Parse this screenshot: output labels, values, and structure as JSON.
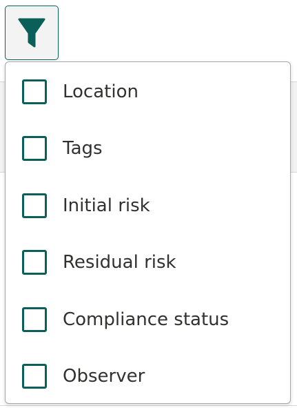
{
  "toolbar": {
    "filter_icon": "filter-icon",
    "accent_color": "#0b5f59"
  },
  "filter_menu": {
    "options": [
      {
        "label": "Location",
        "checked": false
      },
      {
        "label": "Tags",
        "checked": false
      },
      {
        "label": "Initial risk",
        "checked": false
      },
      {
        "label": "Residual risk",
        "checked": false
      },
      {
        "label": "Compliance status",
        "checked": false
      },
      {
        "label": "Observer",
        "checked": false
      }
    ]
  }
}
